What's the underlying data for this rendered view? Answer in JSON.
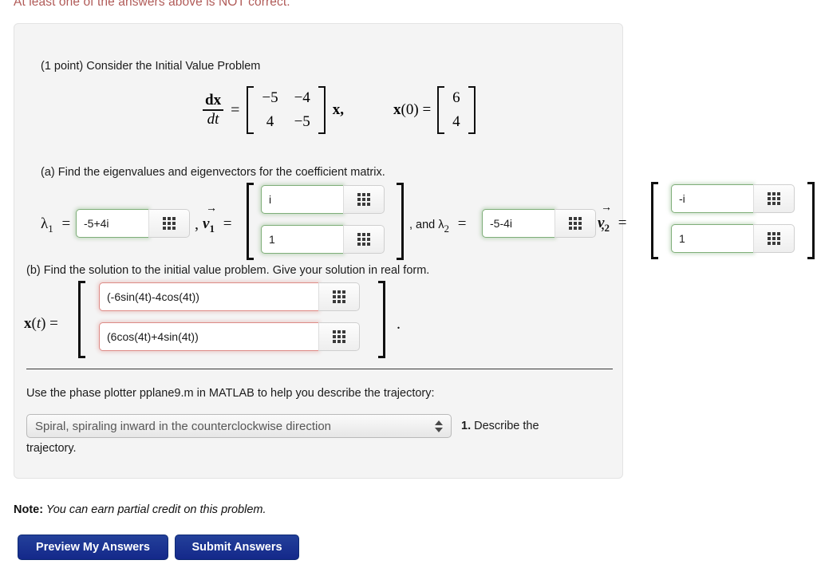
{
  "warning": "At least one of the answers above is NOT correct.",
  "problem": {
    "intro": "(1 point) Consider the Initial Value Problem",
    "equation": {
      "lhs_numerator": "dx",
      "lhs_denominator": "dt",
      "equals": "=",
      "matrix": [
        [
          "−5",
          "−4"
        ],
        [
          "4",
          "−5"
        ]
      ],
      "after_matrix": "x,",
      "initial_label": "x(0) =",
      "initial_vector": [
        "6",
        "4"
      ]
    },
    "part_a": {
      "prompt": "(a) Find the eigenvalues and eigenvectors for the coefficient matrix.",
      "lambda1_label": "λ",
      "lambda1_sub": "1",
      "lambda1_equals": "=",
      "lambda1_value": "-5+4i",
      "comma1": ",",
      "v1_label": "v",
      "v1_sub": "1",
      "v1_equals": "=",
      "v1_values": [
        "i",
        "1"
      ],
      "and_lambda2": ", and λ",
      "lambda2_sub": "2",
      "lambda2_equals": "=",
      "lambda2_value": "-5-4i",
      "comma2": ",",
      "v2_label": "v",
      "v2_sub": "2",
      "v2_equals": "=",
      "v2_values": [
        "-i",
        "1"
      ]
    },
    "part_b": {
      "prompt": "(b) Find the solution to the initial value problem. Give your solution in real form.",
      "xt_label": "x(t) =",
      "values": [
        "(-6sin(4t)-4cos(4t))",
        "(6cos(4t)+4sin(4t))"
      ],
      "trailing_period": "."
    },
    "phase_plotter": {
      "prompt": "Use the phase plotter pplane9.m in MATLAB to help you describe the trajectory:",
      "selected_option": "Spiral, spiraling inward in the counterclockwise direction",
      "question_number": "1.",
      "question_text": " Describe the",
      "question_text_line2": "trajectory."
    }
  },
  "note": {
    "label": "Note:",
    "text": " You can earn partial credit on this problem."
  },
  "buttons": {
    "preview": "Preview My Answers",
    "submit": "Submit Answers"
  },
  "icons": {
    "grid": "grid-icon"
  },
  "colors": {
    "warning": "#b05a57",
    "correct_border": "#7fae79",
    "incorrect_border": "#dd8a86",
    "button_blue": "#14288a",
    "panel_bg": "#f4f4f4"
  }
}
